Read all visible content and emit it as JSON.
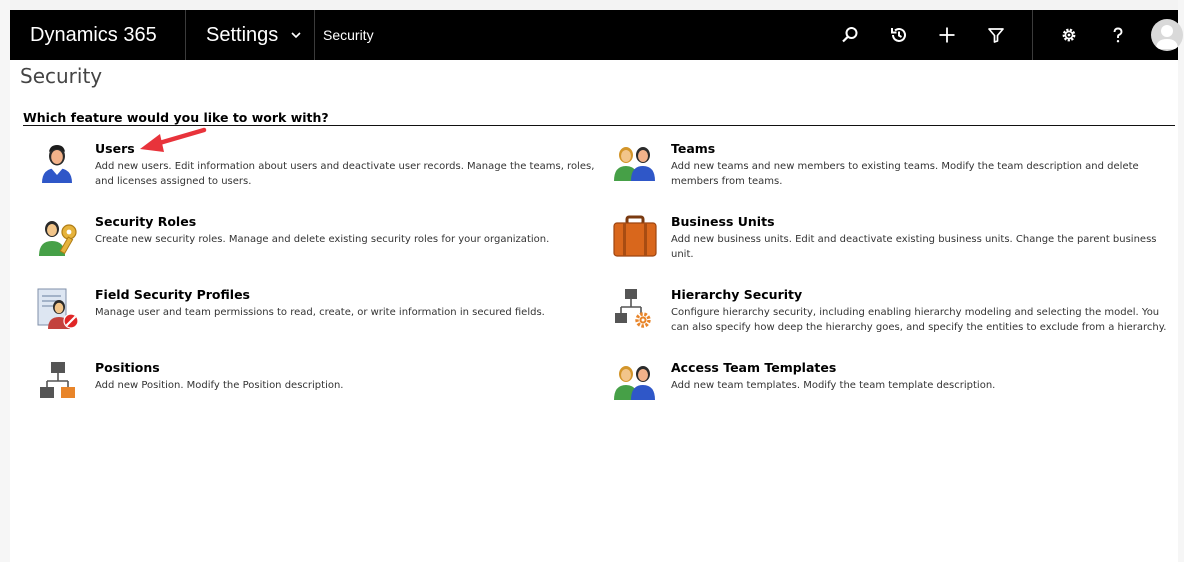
{
  "navbar": {
    "app_name": "Dynamics 365",
    "area": "Settings",
    "breadcrumb": "Security"
  },
  "page": {
    "title": "Security",
    "section_heading": "Which feature would you like to work with?"
  },
  "features": [
    {
      "title": "Users",
      "description": "Add new users. Edit information about users and deactivate user records. Manage the teams, roles, and licenses assigned to users.",
      "icon": "user-icon"
    },
    {
      "title": "Teams",
      "description": "Add new teams and new members to existing teams. Modify the team description and delete members from teams.",
      "icon": "team-icon"
    },
    {
      "title": "Security Roles",
      "description": "Create new security roles. Manage and delete existing security roles for your organization.",
      "icon": "user-key-icon"
    },
    {
      "title": "Business Units",
      "description": "Add new business units. Edit and deactivate existing business units. Change the parent business unit.",
      "icon": "briefcase-icon"
    },
    {
      "title": "Field Security Profiles",
      "description": "Manage user and team permissions to read, create, or write information in secured fields.",
      "icon": "field-security-icon"
    },
    {
      "title": "Hierarchy Security",
      "description": "Configure hierarchy security, including enabling hierarchy modeling and selecting the model. You can also specify how deep the hierarchy goes, and specify the entities to exclude from a hierarchy.",
      "icon": "hierarchy-settings-icon"
    },
    {
      "title": "Positions",
      "description": "Add new Position. Modify the Position description.",
      "icon": "hierarchy-icon"
    },
    {
      "title": "Access Team Templates",
      "description": "Add new team templates. Modify the team template description.",
      "icon": "team-icon"
    }
  ],
  "colors": {
    "navbar_bg": "#000000",
    "annotation_arrow": "#e8333b"
  }
}
